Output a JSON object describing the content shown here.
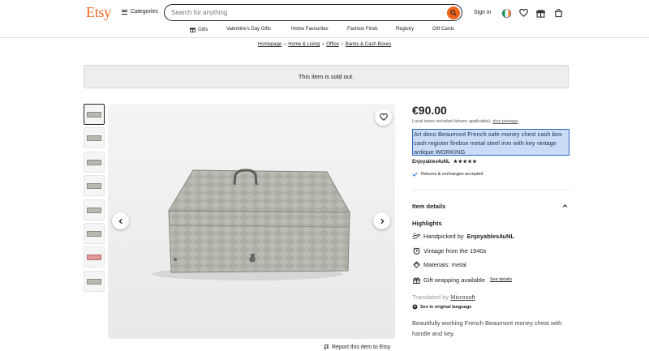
{
  "header": {
    "logo": "Etsy",
    "categories_label": "Categories",
    "search_placeholder": "Search for anything",
    "signin_label": "Sign in"
  },
  "nav": {
    "items": [
      "Gifts",
      "Valentine's Day Gifts",
      "Home Favourites",
      "Fashion Finds",
      "Registry",
      "Gift Cards"
    ]
  },
  "breadcrumbs": [
    "Homepage",
    "Home & Living",
    "Office",
    "Banks & Cash Boxes"
  ],
  "notice": "This item is sold out.",
  "listing": {
    "price": "€90.00",
    "tax_note": "Local taxes included (where applicable),",
    "postage_link": "plus postage",
    "title": "Art deco Beaumont French safe money chest cash box cash register firebox metal steel iron with key vintage antique WORKING",
    "seller": "Enjoyables4uNL",
    "stars": "★★★★★",
    "returns": "Returns & exchanges accepted",
    "item_details": "Item details",
    "highlights_label": "Highlights",
    "handpicked_prefix": "Handpicked by",
    "handpicked_by": "Enjoyables4uNL",
    "vintage": "Vintage from the 1940s",
    "materials": "Materials: metal",
    "gift_wrap": "Gift wrapping available",
    "see_details": "See details",
    "translated_by": "Translated by",
    "translator": "Microsoft",
    "see_original": "See in original language",
    "description": "Beautifully working French Beaumont money chest with handle and key.",
    "report": "Report this item to Etsy"
  },
  "colors": {
    "brand": "#f1641e",
    "selection": "#c8dcf6"
  }
}
